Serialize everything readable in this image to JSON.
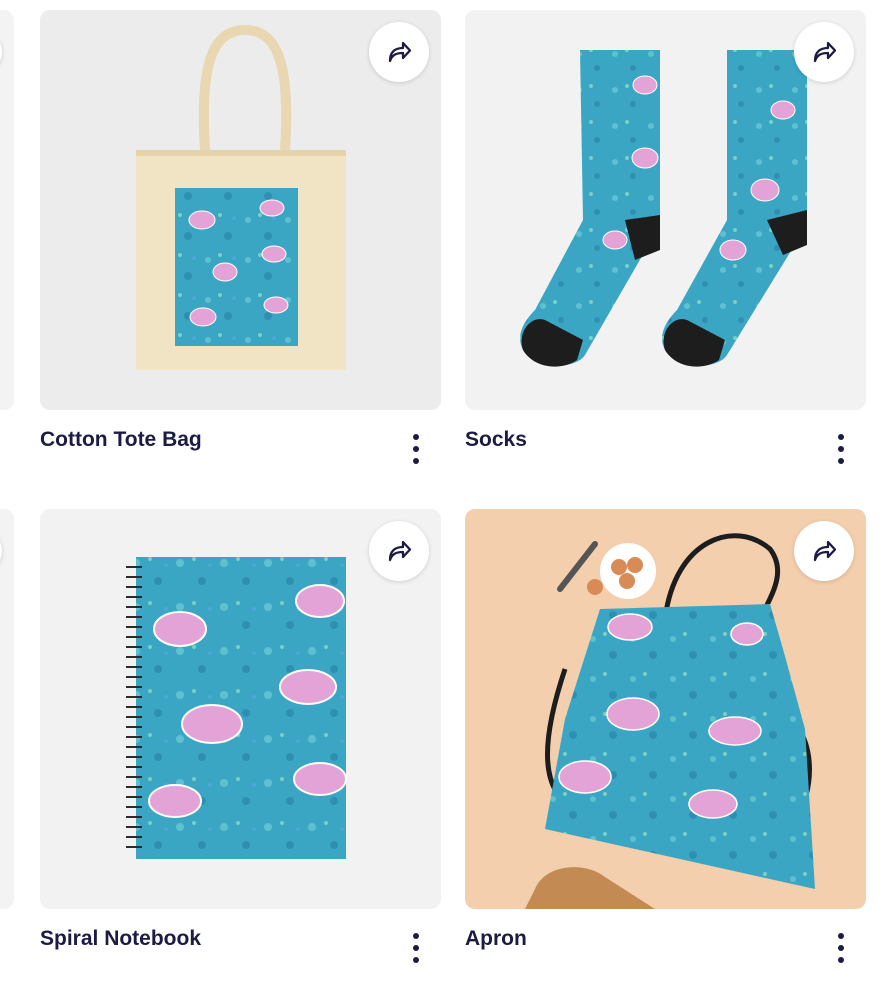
{
  "products": [
    {
      "title": "Cotton Tote Bag",
      "share_icon": "share-arrow-icon",
      "menu_icon": "more-vertical-icon"
    },
    {
      "title": "Socks",
      "share_icon": "share-arrow-icon",
      "menu_icon": "more-vertical-icon"
    },
    {
      "title": "Spiral Notebook",
      "share_icon": "share-arrow-icon",
      "menu_icon": "more-vertical-icon"
    },
    {
      "title": "Apron",
      "share_icon": "share-arrow-icon",
      "menu_icon": "more-vertical-icon"
    }
  ],
  "colors": {
    "title_text": "#1c1b44",
    "ocean": "#3aa6c4",
    "turtle_shell": "#e3a3d6",
    "canvas_bg": "#f0f0f0",
    "wood_bg": "#f3cfae"
  }
}
